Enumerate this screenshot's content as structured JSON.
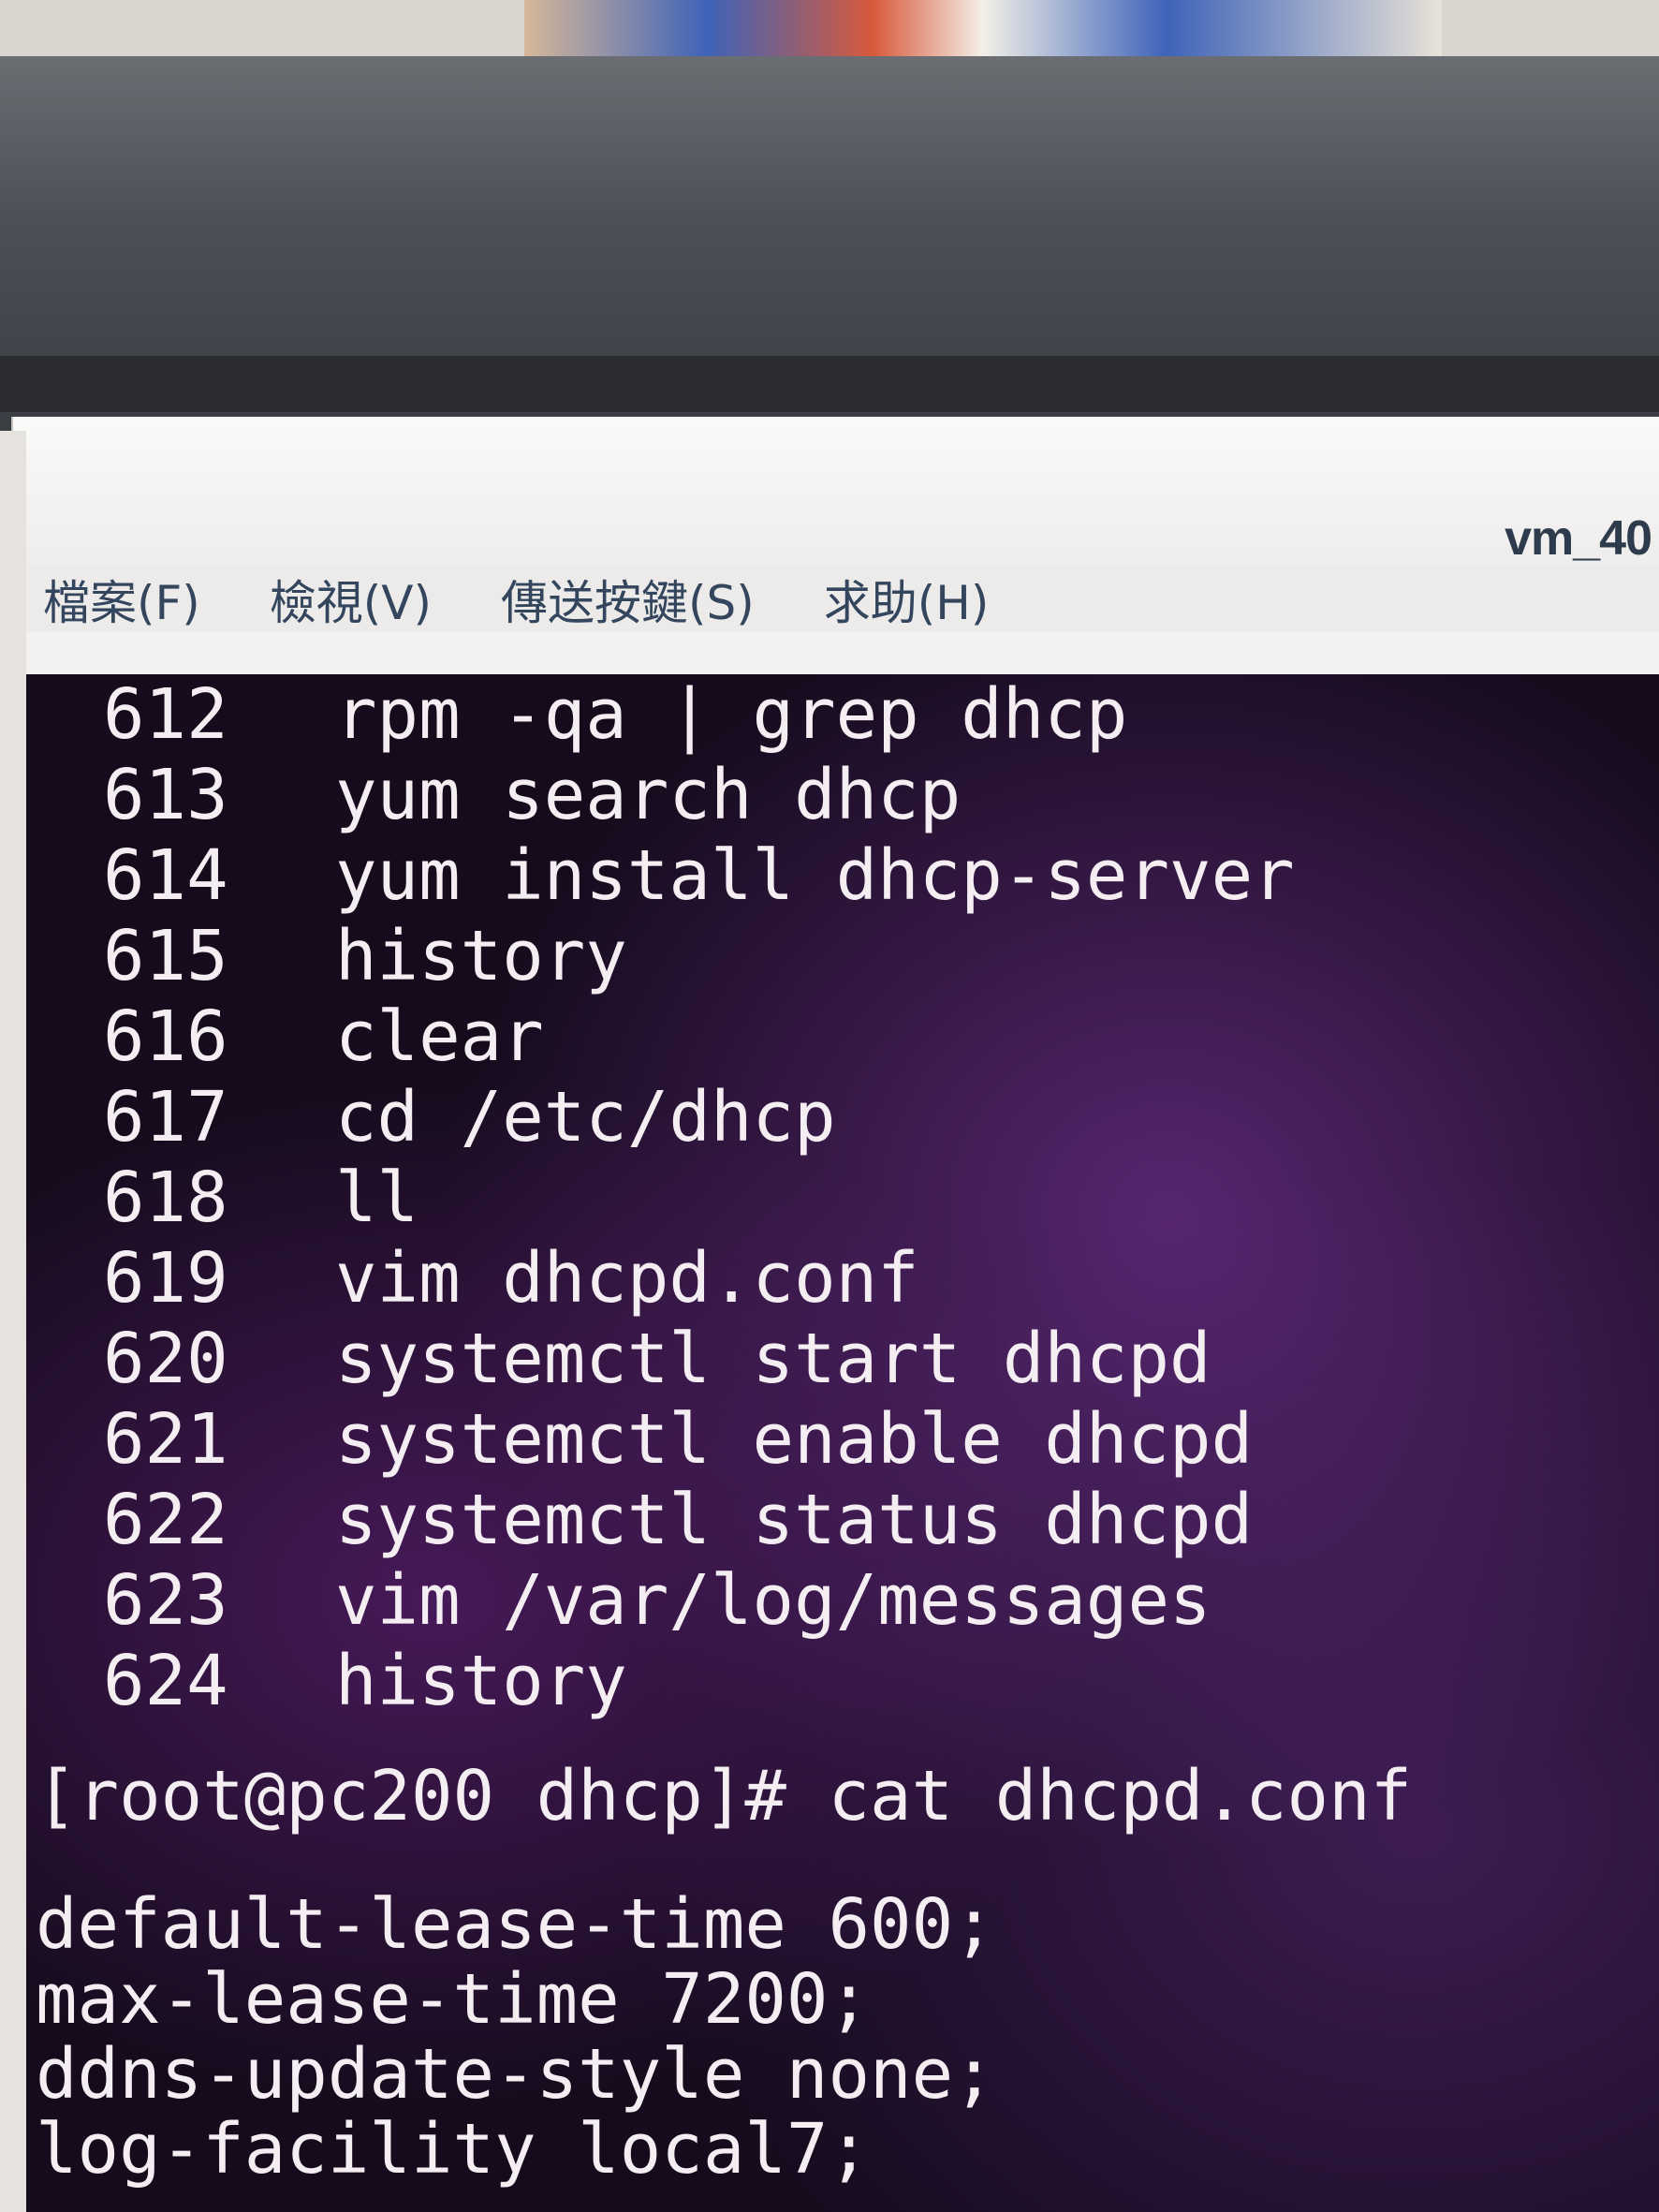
{
  "window": {
    "title": "vm_40"
  },
  "menu": [
    {
      "label": "檔案(F)"
    },
    {
      "label": "檢視(V)"
    },
    {
      "label": "傳送按鍵(S)"
    },
    {
      "label": "求助(H)"
    }
  ],
  "terminal": {
    "history": [
      {
        "num": "612",
        "cmd": "rpm -qa | grep dhcp"
      },
      {
        "num": "613",
        "cmd": "yum search dhcp"
      },
      {
        "num": "614",
        "cmd": "yum install dhcp-server"
      },
      {
        "num": "615",
        "cmd": "history"
      },
      {
        "num": "616",
        "cmd": "clear"
      },
      {
        "num": "617",
        "cmd": "cd /etc/dhcp"
      },
      {
        "num": "618",
        "cmd": "ll"
      },
      {
        "num": "619",
        "cmd": "vim dhcpd.conf"
      },
      {
        "num": "620",
        "cmd": "systemctl start dhcpd"
      },
      {
        "num": "621",
        "cmd": "systemctl enable dhcpd"
      },
      {
        "num": "622",
        "cmd": "systemctl status dhcpd"
      },
      {
        "num": "623",
        "cmd": "vim /var/log/messages"
      },
      {
        "num": "624",
        "cmd": "history"
      }
    ],
    "prompt": "[root@pc200 dhcp]# cat dhcpd.conf",
    "output": [
      "default-lease-time 600;",
      "max-lease-time 7200;",
      "ddns-update-style none;",
      "log-facility local7;"
    ]
  }
}
